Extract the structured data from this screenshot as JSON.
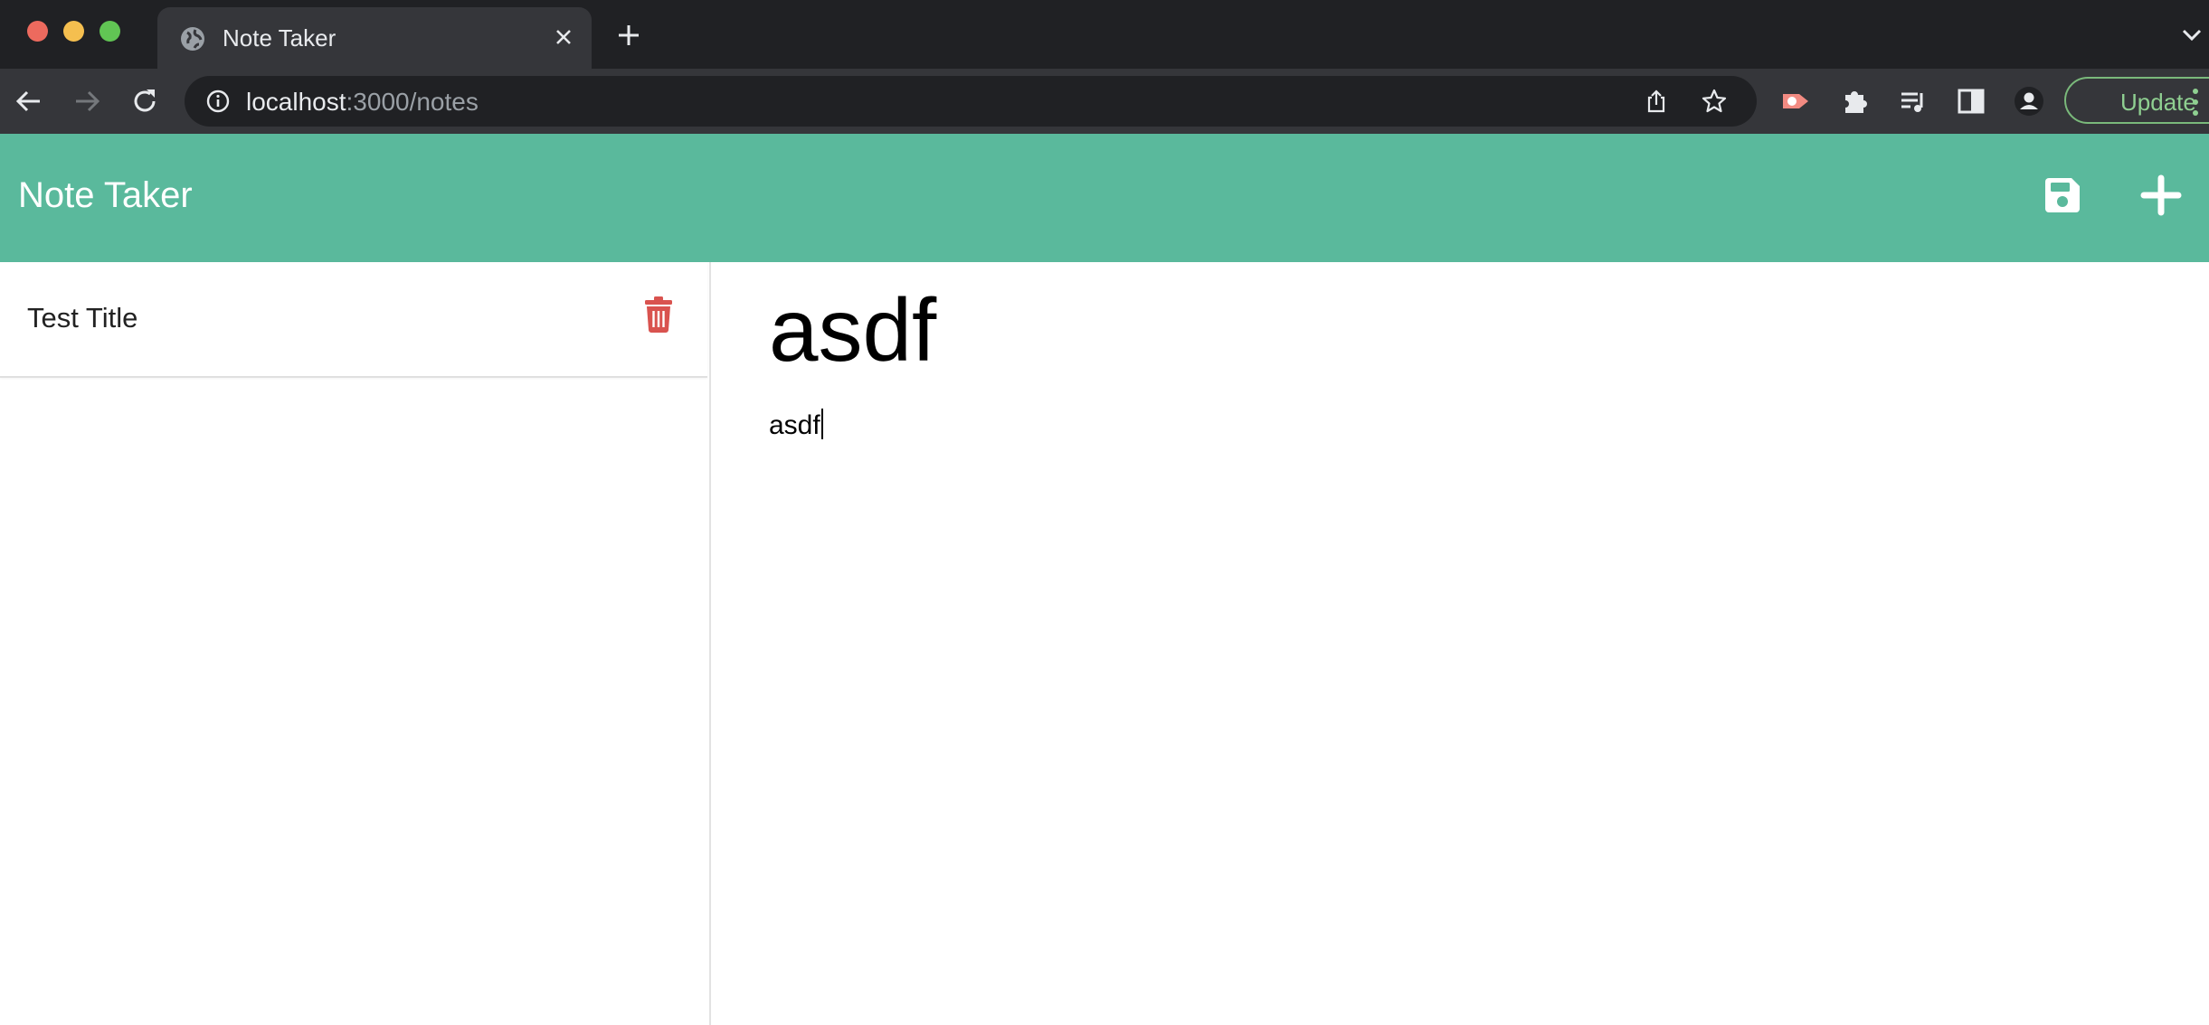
{
  "browser": {
    "tab_title": "Note Taker",
    "url_host": "localhost",
    "url_rest": ":3000/notes",
    "update_label": "Update"
  },
  "app": {
    "brand": "Note Taker"
  },
  "notes": [
    {
      "title": "Test Title"
    }
  ],
  "active_note": {
    "title": "asdf",
    "body": "asdf"
  },
  "colors": {
    "header_bg": "#5ab99c",
    "delete_icon": "#d9534f",
    "chrome_dark": "#202124",
    "chrome_toolbar": "#35363a"
  }
}
